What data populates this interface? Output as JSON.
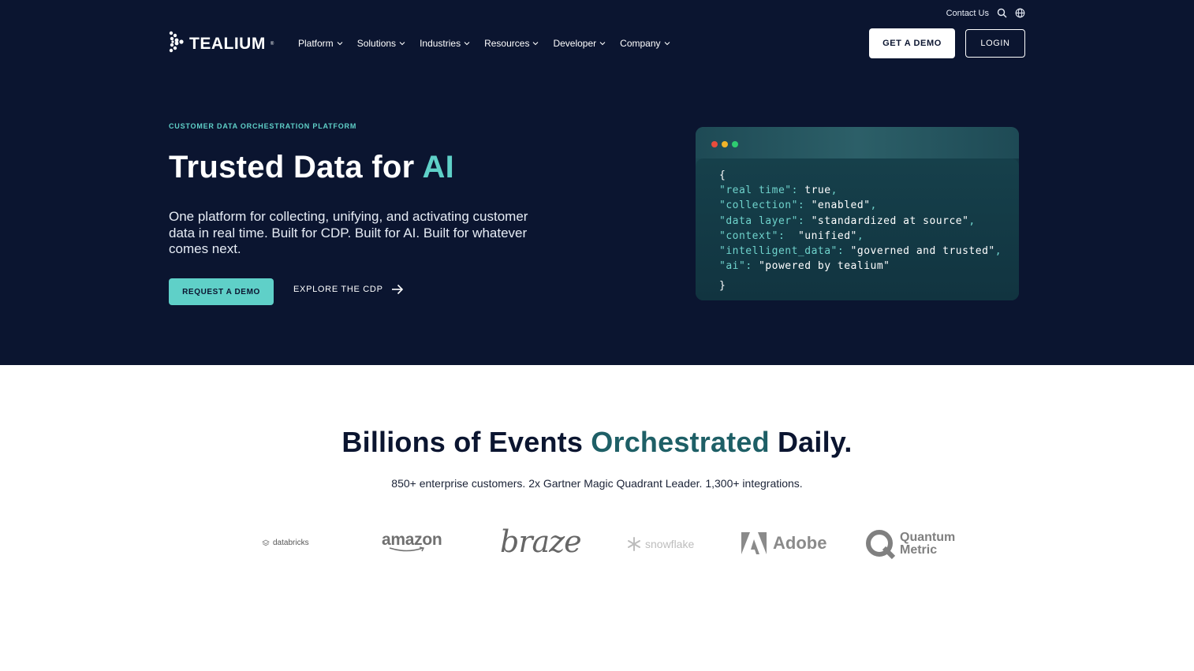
{
  "utility": {
    "contact": "Contact Us"
  },
  "logo": {
    "name": "TEALIUM",
    "mark": "®"
  },
  "nav": [
    {
      "label": "Platform"
    },
    {
      "label": "Solutions"
    },
    {
      "label": "Industries"
    },
    {
      "label": "Resources"
    },
    {
      "label": "Developer"
    },
    {
      "label": "Company"
    }
  ],
  "header": {
    "demo_label": "GET A DEMO",
    "login_label": "LOGIN"
  },
  "hero": {
    "eyebrow": "CUSTOMER DATA ORCHESTRATION PLATFORM",
    "headline_main": "Trusted Data for ",
    "headline_accent": "AI",
    "subhead": "One platform for collecting, unifying, and activating customer data in real time. Built for CDP. Built for AI. Built for whatever comes next.",
    "cta_primary": "REQUEST A DEMO",
    "cta_secondary": "EXPLORE THE CDP"
  },
  "code": {
    "open": "{",
    "lines": [
      {
        "key": "\"real time\"",
        "sep": ": ",
        "value": "true",
        "tail": ","
      },
      {
        "key": "\"collection\"",
        "sep": ": ",
        "value": "\"enabled\"",
        "tail": ","
      },
      {
        "key": "\"data layer\"",
        "sep": ": ",
        "value": "\"standardized at source\"",
        "tail": ","
      },
      {
        "key": "\"context\"",
        "sep": ":  ",
        "value": "\"unified\"",
        "tail": ","
      },
      {
        "key": "\"intelligent_data\"",
        "sep": ": ",
        "value": "\"governed and trusted\"",
        "tail": ","
      },
      {
        "key": "\"ai\"",
        "sep": ": ",
        "value": "\"powered by tealium\"",
        "tail": ""
      }
    ],
    "close": "}"
  },
  "stats": {
    "title_pre": "Billions of Events ",
    "title_accent": "Orchestrated",
    "title_post": " Daily.",
    "subtitle": "850+ enterprise customers. 2x Gartner Magic Quadrant Leader. 1,300+ integrations."
  },
  "brands": {
    "databricks": "databricks",
    "amazon": "amazon",
    "braze": "braze",
    "snowflake": "snowflake",
    "adobe": "Adobe",
    "quantum_1": "Quantum",
    "quantum_2": "Metric"
  },
  "colors": {
    "navy": "#0b1530",
    "teal": "#5fd0c8",
    "dark_teal": "#1e5f66"
  }
}
